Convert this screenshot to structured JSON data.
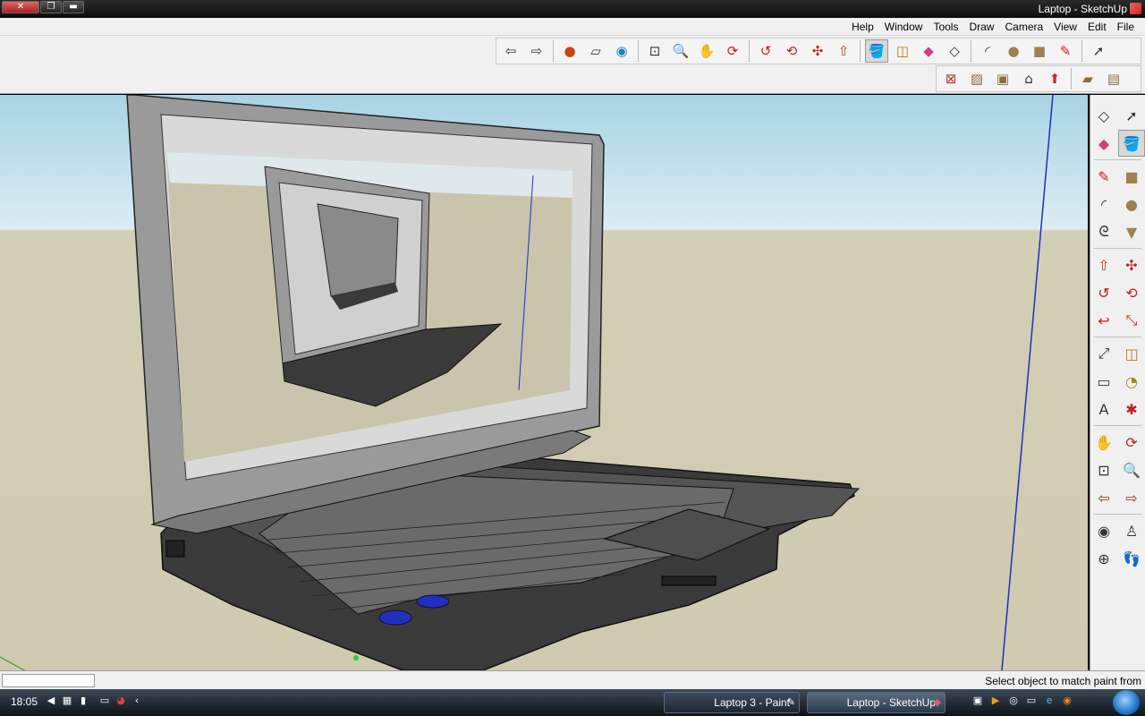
{
  "window": {
    "title": "Laptop - SketchUp",
    "controls": {
      "close": "✕",
      "restore": "❐",
      "minimize": "▬"
    }
  },
  "menu": [
    "File",
    "Edit",
    "View",
    "Camera",
    "Draw",
    "Tools",
    "Window",
    "Help"
  ],
  "toolbar": {
    "row1_icons": [
      "select-icon",
      "pencil-icon",
      "rectangle-icon",
      "circle-icon",
      "arc-icon",
      "make-component-icon",
      "eraser-icon",
      "tape-measure-icon",
      "paint-bucket-icon",
      "push-pull-icon",
      "move-icon",
      "rotate-icon",
      "follow-me-icon",
      "orbit-icon",
      "pan-icon",
      "zoom-icon",
      "zoom-extents-icon",
      "get-models-icon",
      "share-model-icon",
      "google-earth-icon",
      "photo-texture-icon",
      "previous-view-icon",
      "next-view-icon"
    ],
    "row2_icons": [
      "iso-view-icon",
      "top-view-icon",
      "front-view-icon",
      "right-view-icon",
      "back-view-icon",
      "left-view-icon",
      "xray-icon"
    ]
  },
  "right_tools": [
    "select-icon",
    "make-component-icon",
    "paint-bucket-icon",
    "eraser-icon",
    "rectangle-icon",
    "line-icon",
    "circle-icon",
    "arc-icon",
    "polygon-icon",
    "freehand-icon",
    "move-icon",
    "push-pull-icon",
    "rotate-icon",
    "follow-me-icon",
    "scale-icon",
    "offset-icon",
    "tape-measure-icon",
    "dimension-icon",
    "protractor-icon",
    "text-icon",
    "axes-icon",
    "3d-text-icon",
    "orbit-icon",
    "pan-icon",
    "zoom-icon",
    "zoom-window-icon",
    "zoom-extents-icon",
    "previous-icon",
    "position-camera-icon",
    "walk-icon",
    "look-around-icon",
    "section-plane-icon"
  ],
  "status": {
    "message": "Select object to match paint from",
    "measurements": ""
  },
  "taskbar": {
    "clock": "18:05",
    "tasks": [
      "Laptop 3 - Paint",
      "Laptop - SketchUp"
    ]
  },
  "colors": {
    "sky": "#a8d3e4",
    "ground": "#cfcab0",
    "laptop_body": "#3e3e3e",
    "accent_blue": "#1f30c0"
  }
}
